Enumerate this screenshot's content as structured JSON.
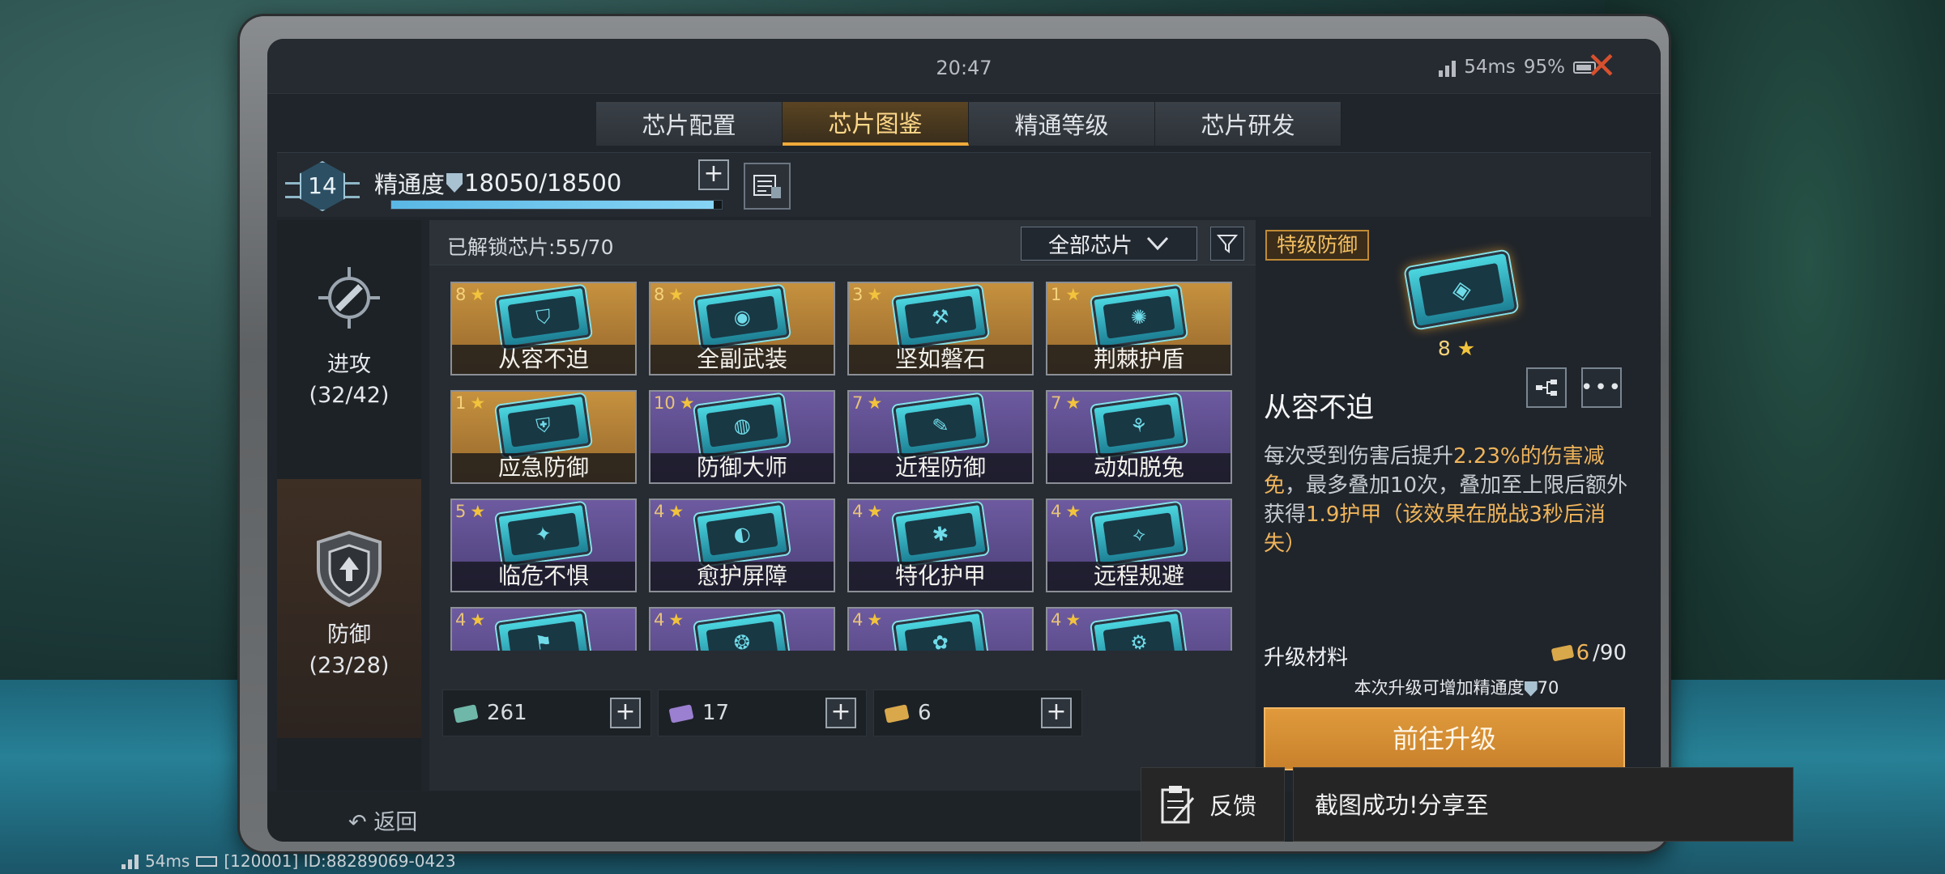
{
  "status": {
    "time": "20:47",
    "ping": "54ms",
    "battery": "95%"
  },
  "tabs": [
    {
      "label": "芯片配置",
      "active": false
    },
    {
      "label": "芯片图鉴",
      "active": true
    },
    {
      "label": "精通等级",
      "active": false
    },
    {
      "label": "芯片研发",
      "active": false
    }
  ],
  "mastery": {
    "level": "14",
    "label": "精通度",
    "value": "18050/18500",
    "progress": 0.976
  },
  "leftnav": {
    "attack": {
      "label": "进攻",
      "count": "(32/42)"
    },
    "defense": {
      "label": "防御",
      "count": "(23/28)"
    }
  },
  "main": {
    "unlocked": "已解锁芯片:55/70",
    "filter_label": "全部芯片"
  },
  "chips": [
    {
      "name": "从容不迫",
      "stars": "8",
      "tier": "gold"
    },
    {
      "name": "全副武装",
      "stars": "8",
      "tier": "gold"
    },
    {
      "name": "坚如磐石",
      "stars": "3",
      "tier": "gold"
    },
    {
      "name": "荆棘护盾",
      "stars": "1",
      "tier": "gold"
    },
    {
      "name": "应急防御",
      "stars": "1",
      "tier": "gold"
    },
    {
      "name": "防御大师",
      "stars": "10",
      "tier": "purple"
    },
    {
      "name": "近程防御",
      "stars": "7",
      "tier": "purple"
    },
    {
      "name": "动如脱兔",
      "stars": "7",
      "tier": "purple"
    },
    {
      "name": "临危不惧",
      "stars": "5",
      "tier": "purple"
    },
    {
      "name": "愈护屏障",
      "stars": "4",
      "tier": "purple"
    },
    {
      "name": "特化护甲",
      "stars": "4",
      "tier": "purple"
    },
    {
      "name": "远程规避",
      "stars": "4",
      "tier": "purple"
    },
    {
      "name": "",
      "stars": "4",
      "tier": "purple"
    },
    {
      "name": "",
      "stars": "4",
      "tier": "purple"
    },
    {
      "name": "",
      "stars": "4",
      "tier": "purple"
    },
    {
      "name": "",
      "stars": "4",
      "tier": "purple"
    }
  ],
  "resources": [
    {
      "value": "261",
      "color": "#6fb7a8"
    },
    {
      "value": "17",
      "color": "#9b7fd0"
    },
    {
      "value": "6",
      "color": "#d9a84a"
    }
  ],
  "detail": {
    "rarity": "特级防御",
    "stars": "8",
    "name": "从容不迫",
    "desc_1": "每次受到伤害后提升",
    "desc_hl1": "2.23%的伤害减免",
    "desc_2": "，最多叠加10次，叠加至上限后额外获得",
    "desc_hl2": "1.9护甲（该效果在脱战3秒后消失）",
    "materials_label": "升级材料",
    "materials_current": "6",
    "materials_total": "/90",
    "note": "本次升级可增加精通度",
    "note_value": "70",
    "upgrade_button": "前往升级"
  },
  "footer": {
    "back": "返回"
  },
  "overlay": {
    "feedback": "反馈",
    "toast": "截图成功!分享至"
  },
  "netinfo": {
    "ping": "54ms",
    "id": "[120001] ID:88289069-0423"
  }
}
